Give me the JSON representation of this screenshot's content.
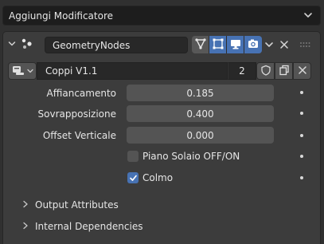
{
  "add_modifier": {
    "label": "Aggiungi Modificatore"
  },
  "modifier": {
    "name": "GeometryNodes",
    "node_group": {
      "name": "Coppi V1.1",
      "users": "2"
    },
    "properties": [
      {
        "label": "Affiancamento",
        "value": "0.185"
      },
      {
        "label": "Sovrapposizione",
        "value": "0.400"
      },
      {
        "label": "Offset Verticale",
        "value": "0.000"
      }
    ],
    "toggles": [
      {
        "label": "Piano Solaio OFF/ON",
        "checked": false
      },
      {
        "label": "Colmo",
        "checked": true
      }
    ],
    "subpanels": [
      {
        "label": "Output Attributes",
        "expanded": false
      },
      {
        "label": "Internal Dependencies",
        "expanded": false
      }
    ]
  },
  "colors": {
    "accent": "#4772b3",
    "background": "#303030",
    "panel": "#3c3c3c",
    "field": "#545454"
  }
}
